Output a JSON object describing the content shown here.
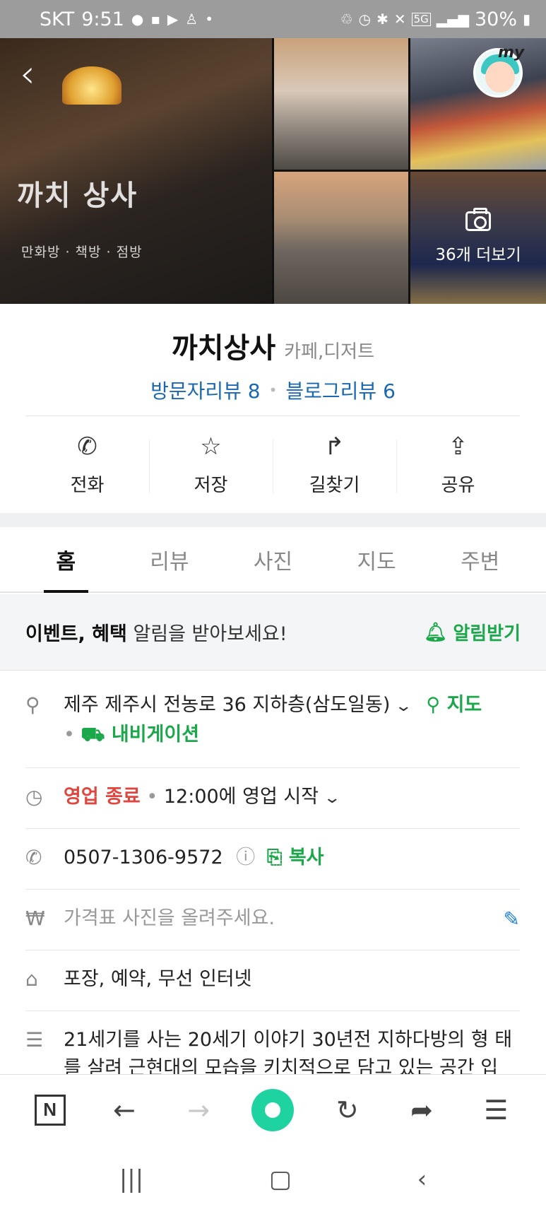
{
  "status_bar": {
    "carrier": "SKT",
    "time": "9:51",
    "battery": "30%",
    "network": "5G"
  },
  "photos": {
    "more_label": "36개 더보기",
    "glass_sign": "까치 상사",
    "glass_sub": "만화방 · 책방 · 점방",
    "avatar_badge": "my"
  },
  "place": {
    "name": "까치상사",
    "category": "카페,디저트",
    "visitor_reviews": "방문자리뷰 8",
    "blog_reviews": "블로그리뷰 6"
  },
  "actions": [
    {
      "label": "전화",
      "icon": "phone-icon"
    },
    {
      "label": "저장",
      "icon": "star-icon"
    },
    {
      "label": "길찾기",
      "icon": "directions-icon"
    },
    {
      "label": "공유",
      "icon": "share-icon"
    }
  ],
  "tabs": [
    {
      "label": "홈",
      "active": true
    },
    {
      "label": "리뷰",
      "active": false
    },
    {
      "label": "사진",
      "active": false
    },
    {
      "label": "지도",
      "active": false
    },
    {
      "label": "주변",
      "active": false
    }
  ],
  "notice": {
    "bold": "이벤트, 혜택",
    "text": " 알림을 받아보세요!",
    "button": "알림받기"
  },
  "info": {
    "address": "제주 제주시 전농로 36 지하층(삼도일동)",
    "map_link": "지도",
    "navigation_link": "내비게이션",
    "status": "영업 종료",
    "hours": "12:00에 영업 시작",
    "phone": "0507-1306-9572",
    "copy_label": "복사",
    "price_prompt": "가격표 사진을 올려주세요.",
    "amenities": "포장, 예약, 무선 인터넷",
    "description": "21세기를 사는 20세기 이야기 30년전 지하다방의 형 태를 살려 근현대의 모습을 키치적으로 담고 있는 공간 입"
  },
  "colors": {
    "accent_green": "#1ba84a",
    "link_blue": "#1a68b0",
    "closed_red": "#e0463d"
  }
}
